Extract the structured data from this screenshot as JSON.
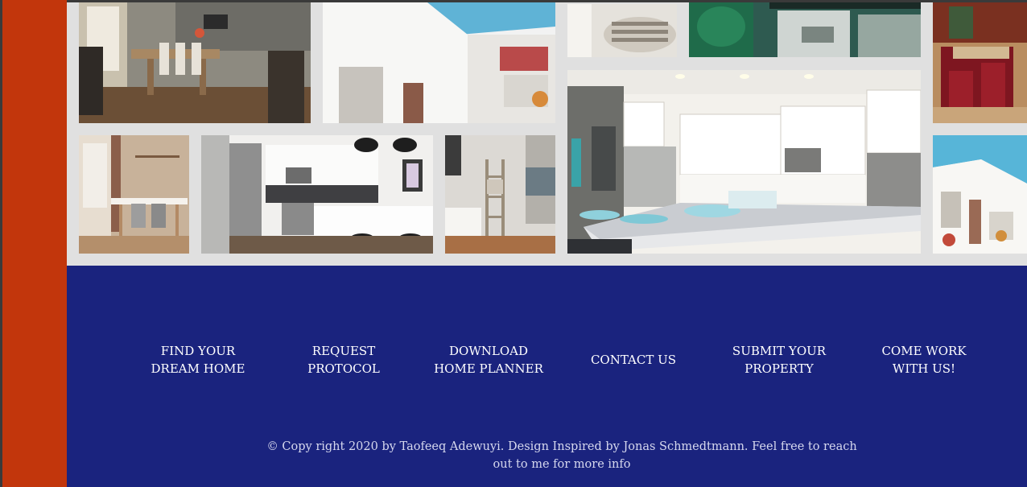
{
  "gallery": {
    "photos": [
      {
        "name": "dining-room-photo",
        "alt": "dining room"
      },
      {
        "name": "white-building-photo",
        "alt": "white building exterior"
      },
      {
        "name": "pillows-photo",
        "alt": "pillows"
      },
      {
        "name": "green-living-photo",
        "alt": "green living room"
      },
      {
        "name": "red-kitchen-photo",
        "alt": "red cabinet kitchen"
      },
      {
        "name": "dining-table-photo",
        "alt": "dining table"
      },
      {
        "name": "white-kitchen-photo",
        "alt": "white kitchen"
      },
      {
        "name": "ladder-room-photo",
        "alt": "room with ladder"
      },
      {
        "name": "large-kitchen-photo",
        "alt": "large kitchen with island"
      },
      {
        "name": "white-building-2-photo",
        "alt": "white building exterior"
      }
    ]
  },
  "footer": {
    "nav": [
      {
        "label": "FIND YOUR\nDREAM HOME"
      },
      {
        "label": "REQUEST\nPROTOCOL"
      },
      {
        "label": "DOWNLOAD\nHOME PLANNER"
      },
      {
        "label": "CONTACT US"
      },
      {
        "label": "SUBMIT YOUR\nPROPERTY"
      },
      {
        "label": "COME WORK\nWITH US!"
      }
    ],
    "copyright": "© Copy right 2020 by Taofeeq Adewuyi. Design Inspired by Jonas Schmedtmann. Feel free to reach out to me for more info"
  },
  "colors": {
    "sidebar": "#c2360c",
    "footer_bg": "#1a237e",
    "gallery_bg": "#e0e0e0"
  }
}
